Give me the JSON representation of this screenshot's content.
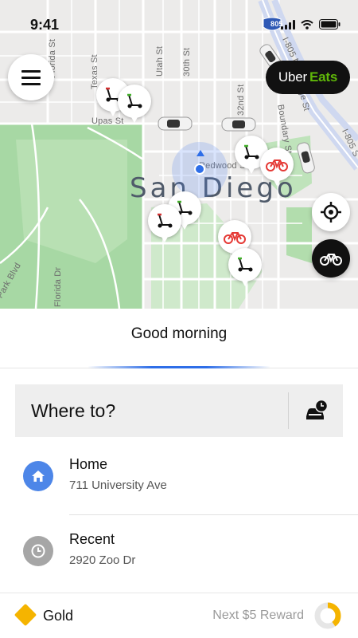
{
  "status_bar": {
    "time": "9:41",
    "highway_shield": "805"
  },
  "map": {
    "city": "San Diego",
    "streets": {
      "florida_top": "Florida St",
      "texas": "Texas St",
      "utah": "Utah St",
      "thirtieth": "30th St",
      "thirtysecond": "32nd St",
      "upas": "Upas St",
      "redwood": "Redwood St",
      "boundary": "Boundary St",
      "i805_top": "I-805 N",
      "i805_right": "I-805 S",
      "park_blvd": "Park Blvd",
      "florida_bottom": "Florida Dr",
      "ridge": "Ridge St"
    }
  },
  "buttons": {
    "uber_eats": {
      "brand": "Uber",
      "brand_accent": "Eats"
    }
  },
  "panel": {
    "greeting": "Good morning",
    "search_placeholder": "Where to?",
    "places": [
      {
        "title": "Home",
        "subtitle": "711 University Ave",
        "icon": "home-icon"
      },
      {
        "title": "Recent",
        "subtitle": "2920 Zoo Dr",
        "icon": "clock-icon"
      }
    ]
  },
  "rewards": {
    "tier": "Gold",
    "next_reward": "Next $5 Reward",
    "progress_fraction": 0.4
  },
  "colors": {
    "accent_blue": "#2e6ee8",
    "eats_green": "#5fb709",
    "gold": "#f5b400",
    "park_green": "#a7d8a4",
    "map_background": "#ecebea"
  }
}
